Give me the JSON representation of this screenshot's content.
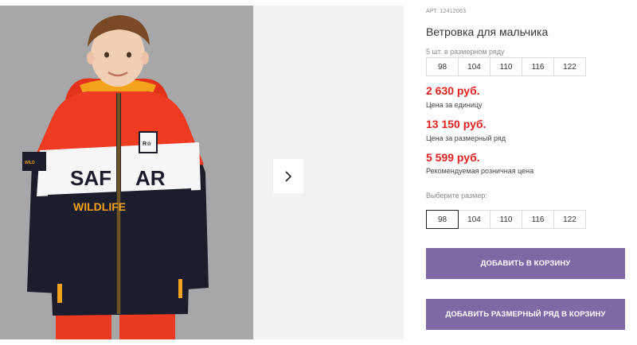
{
  "product": {
    "sku": "АРТ. 12412063",
    "title": "Ветровка для мальчика"
  },
  "size_range": {
    "caption": "5 шт. в размерном ряду",
    "sizes": [
      "98",
      "104",
      "110",
      "116",
      "122"
    ]
  },
  "prices": [
    {
      "amount": "2 630 руб.",
      "note": "Цена за единицу"
    },
    {
      "amount": "13 150 руб.",
      "note": "Цена за размерный ряд"
    },
    {
      "amount": "5 599 руб.",
      "note": "Рекомендуемая розничная цена"
    }
  ],
  "size_picker": {
    "label": "Выберите размер:",
    "sizes": [
      "98",
      "104",
      "110",
      "116",
      "122"
    ],
    "selected": "98"
  },
  "buttons": {
    "add_to_cart": "ДОБАВИТЬ В КОРЗИНУ",
    "add_range_to_cart": "ДОБАВИТЬ РАЗМЕРНЫЙ РЯД В КОРЗИНУ"
  },
  "gallery": {
    "jacket_print_top": "SAF   AR",
    "jacket_print_bottom": "WILDLIFE",
    "patch_left": "WILD SAFARI",
    "patch_right": "ROAR",
    "next_icon": "chevron-right-icon"
  },
  "colors": {
    "price_red": "#e4201e",
    "button_purple": "#7e69a4",
    "jacket_red": "#ee3b22",
    "jacket_navy": "#1b1d2c"
  }
}
